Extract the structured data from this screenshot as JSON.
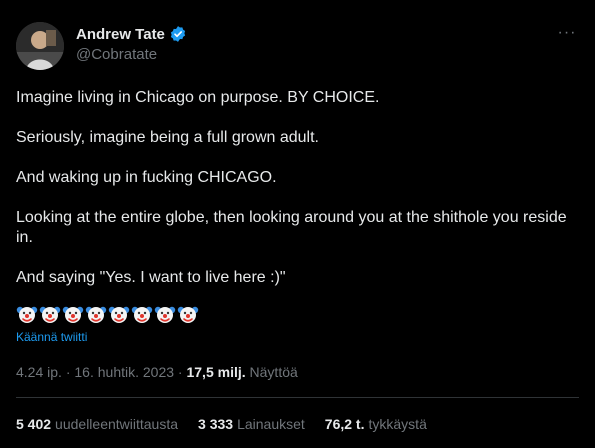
{
  "author": {
    "display_name": "Andrew Tate",
    "handle": "@Cobratate",
    "verified_color": "#1d9bf0"
  },
  "more_label": "···",
  "tweet": {
    "paragraphs": [
      "Imagine living in Chicago on purpose. BY CHOICE.",
      "Seriously, imagine being a full grown adult.",
      "And waking up in fucking CHICAGO.",
      "Looking at the entire globe, then looking around you at the shithole you reside in.",
      "And saying \"Yes. I want to live here :)\""
    ],
    "emoji_count": 8,
    "emoji_icon": "clown-face-icon"
  },
  "translate_label": "Käännä twiitti",
  "meta": {
    "time": "4.24 ip.",
    "separator": "·",
    "date": "16. huhtik. 2023",
    "views_count": "17,5 milj.",
    "views_label": "Näyttöä"
  },
  "stats": [
    {
      "count": "5 402",
      "label": "uudelleentwiittausta"
    },
    {
      "count": "3 333",
      "label": "Lainaukset"
    },
    {
      "count": "76,2 t.",
      "label": "tykkäystä"
    }
  ]
}
